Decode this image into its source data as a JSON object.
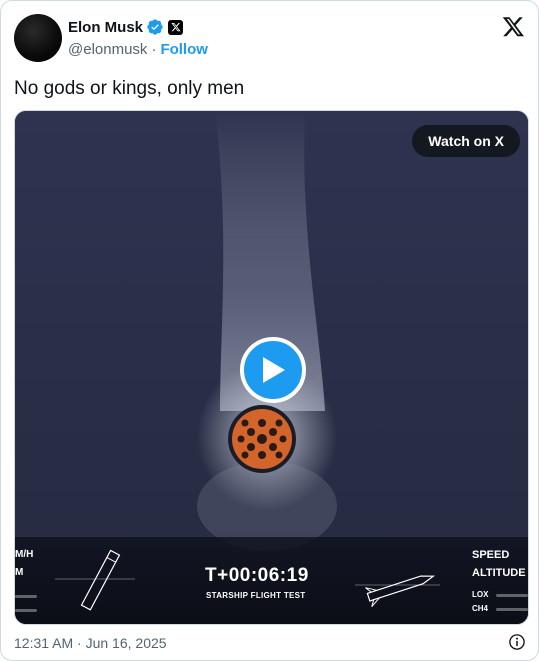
{
  "author": {
    "name": "Elon Musk",
    "handle": "@elonmusk",
    "follow_label": "Follow",
    "separator": "·"
  },
  "tweet": {
    "text": "No gods or kings, only men"
  },
  "media": {
    "watch_label": "Watch on X",
    "hud": {
      "left_label_1": "M/H",
      "left_label_2": "M",
      "timer": "T+00:06:19",
      "subtitle": "STARSHIP FLIGHT TEST",
      "speed_label": "SPEED",
      "altitude_label": "ALTITUDE",
      "lox_label": "LOX",
      "ch4_label": "CH4"
    }
  },
  "footer": {
    "timestamp": "12:31 AM · Jun 16, 2025"
  },
  "icons": {
    "verified": "verified-badge-icon",
    "affiliation": "x-affiliation-icon",
    "brand": "x-logo-icon",
    "play": "play-icon",
    "info": "info-icon"
  },
  "colors": {
    "accent": "#1d9bf0",
    "text": "#0f1419",
    "muted": "#536471",
    "video_bg": "#2b3045"
  }
}
